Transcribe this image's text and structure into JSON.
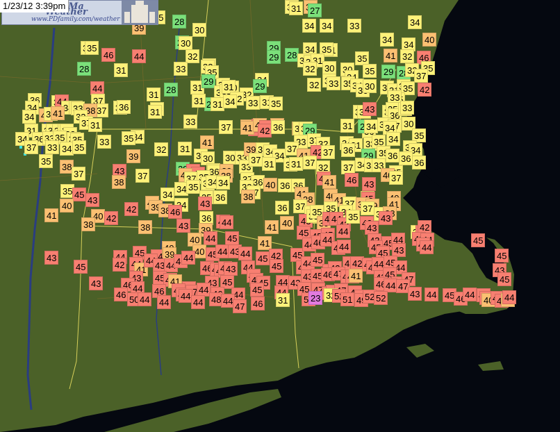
{
  "header": {
    "timestamp": "1/23/12 3:39pm",
    "logo_line1": "rd, Ma",
    "logo_line2": "Weather",
    "logo_url": "www.PDfamily.com/weather"
  },
  "map": {
    "colors": {
      "ocean": "#050810",
      "land": "#4b6128",
      "borders": "#d6cf5a",
      "river": "#2a3d80"
    },
    "temp_colors": {
      "cold": "#7be07a",
      "cool": "#fef27a",
      "mild": "#fbc072",
      "warm": "#f87f71",
      "coldest": "#e27be0"
    },
    "temperatures": [
      31,
      39,
      27,
      35,
      28,
      30,
      34,
      34,
      33,
      34,
      39,
      35,
      28,
      30,
      31,
      29,
      34,
      31,
      35,
      34,
      34,
      40,
      35,
      46,
      44,
      32,
      31,
      29,
      28,
      33,
      34,
      31,
      35,
      41,
      32,
      46,
      28,
      31,
      33,
      32,
      35,
      32,
      30,
      30,
      34,
      35,
      29,
      28,
      32,
      31,
      35,
      34,
      44,
      28,
      31,
      29,
      30,
      30,
      32,
      31,
      33,
      35,
      42,
      36,
      35,
      44,
      37,
      31,
      30,
      31,
      32,
      31,
      29,
      34,
      36,
      30,
      33,
      31,
      33,
      35,
      37,
      35,
      33,
      29,
      31,
      32,
      31,
      37,
      36,
      36,
      34,
      31,
      34,
      33,
      35,
      34,
      34,
      34,
      33,
      38,
      30,
      36,
      43,
      31,
      35,
      36,
      37,
      33,
      34,
      40,
      34,
      41,
      32,
      37,
      31,
      31,
      33,
      37,
      40,
      43,
      42,
      40,
      38,
      39,
      36,
      36,
      37,
      30,
      31,
      34,
      36,
      33,
      36,
      34,
      33,
      33,
      34,
      41,
      40,
      43,
      42,
      36,
      36,
      31,
      29,
      31,
      29,
      34,
      34,
      34,
      36,
      33,
      35,
      35,
      33,
      35,
      41,
      33,
      37,
      32,
      34,
      31,
      33,
      35,
      34,
      35,
      37,
      33,
      34,
      35,
      39,
      32,
      31,
      30,
      30,
      30,
      33,
      39,
      37,
      34,
      34,
      37,
      41,
      42,
      37,
      36,
      29,
      35,
      36,
      36,
      34,
      36,
      35,
      38,
      43,
      29,
      42,
      43,
      34,
      36,
      39,
      33,
      37,
      31,
      34,
      31,
      37,
      32,
      37,
      34,
      35,
      33,
      35,
      36,
      37,
      38,
      37,
      40,
      37,
      35,
      38,
      37,
      36,
      40,
      36,
      36,
      42,
      41,
      46,
      43,
      40,
      37,
      35,
      34,
      34,
      35,
      33,
      34,
      34,
      33,
      37,
      41,
      38,
      40,
      41,
      32,
      45,
      40,
      45,
      43,
      42,
      40,
      39,
      38,
      34,
      35,
      36,
      38,
      36,
      37,
      34,
      33,
      35,
      37,
      38,
      39,
      41,
      41,
      40,
      40,
      42,
      46,
      43,
      36,
      45,
      43,
      33,
      35,
      39,
      34,
      42,
      37,
      35,
      38,
      38,
      38,
      43,
      39,
      41,
      40,
      39,
      45,
      44,
      43,
      35,
      42,
      43,
      36,
      44,
      42,
      40,
      44,
      44,
      45,
      41,
      45,
      45,
      45,
      44,
      43,
      43,
      45,
      44,
      42,
      44,
      43,
      44,
      45,
      44,
      40,
      39,
      40,
      45,
      44,
      43,
      44,
      42,
      45,
      44,
      46,
      44,
      44,
      44,
      45,
      45,
      43,
      46,
      44,
      45,
      45,
      45,
      42,
      44,
      41,
      44,
      43,
      44,
      46,
      44,
      46,
      44,
      44,
      44,
      43,
      44,
      45,
      45,
      43,
      44,
      45,
      46,
      42,
      42,
      42,
      42,
      43,
      44,
      45,
      44,
      43,
      43,
      45,
      46,
      41,
      43,
      43,
      45,
      47,
      44,
      45,
      44,
      43,
      43,
      45,
      46,
      47,
      43,
      44,
      41,
      42,
      45,
      45,
      47,
      45,
      43,
      46,
      44,
      46,
      48,
      44,
      47,
      44,
      46,
      44,
      45,
      44,
      45,
      47,
      47,
      46,
      47,
      46,
      46,
      45,
      46,
      44,
      47,
      43,
      44,
      45,
      46,
      44,
      43,
      43,
      40,
      42,
      43,
      41,
      44,
      46,
      50,
      44,
      44,
      44,
      44,
      48,
      44,
      47,
      46,
      31,
      52,
      23,
      32,
      52,
      51,
      49,
      52,
      52
    ]
  }
}
